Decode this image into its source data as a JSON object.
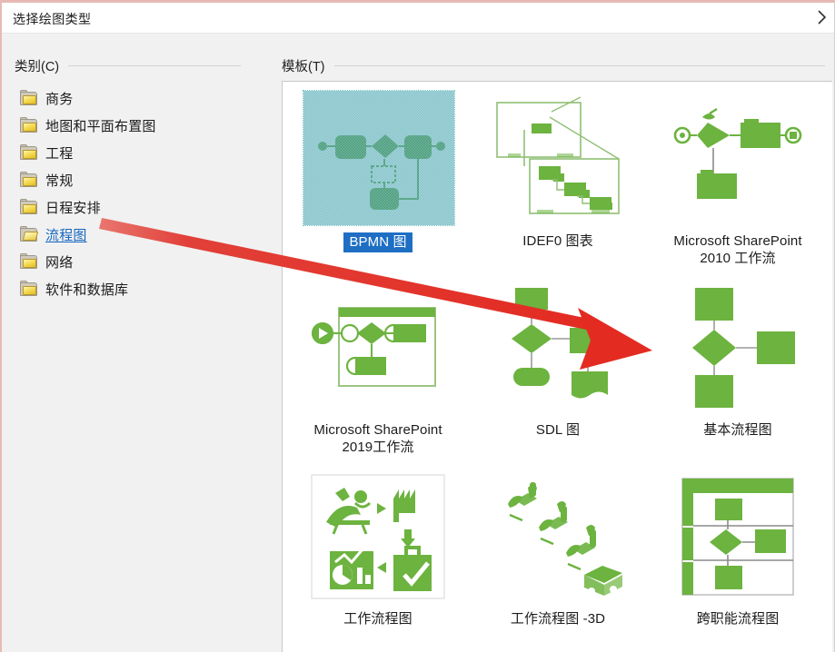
{
  "window": {
    "title": "选择绘图类型",
    "close_glyph": "›"
  },
  "sidebar": {
    "label": "类别(C)",
    "items": [
      {
        "label": "商务",
        "icon": "folder-icon",
        "selected": false
      },
      {
        "label": "地图和平面布置图",
        "icon": "folder-icon",
        "selected": false
      },
      {
        "label": "工程",
        "icon": "folder-icon",
        "selected": false
      },
      {
        "label": "常规",
        "icon": "folder-icon",
        "selected": false
      },
      {
        "label": "日程安排",
        "icon": "folder-icon",
        "selected": false
      },
      {
        "label": "流程图",
        "icon": "folder-open-icon",
        "selected": true
      },
      {
        "label": "网络",
        "icon": "folder-icon",
        "selected": false
      },
      {
        "label": "软件和数据库",
        "icon": "folder-icon",
        "selected": false
      }
    ]
  },
  "templates": {
    "label": "模板(T)",
    "items": [
      {
        "name": "BPMN 图",
        "thumb": "bpmn-thumbnail",
        "selected": true
      },
      {
        "name": "IDEF0 图表",
        "thumb": "idef0-thumbnail",
        "selected": false
      },
      {
        "name": "Microsoft SharePoint\n2010 工作流",
        "thumb": "sharepoint-2010-thumbnail",
        "selected": false
      },
      {
        "name": "Microsoft SharePoint\n2019工作流",
        "thumb": "sharepoint-2019-thumbnail",
        "selected": false
      },
      {
        "name": "SDL 图",
        "thumb": "sdl-thumbnail",
        "selected": false
      },
      {
        "name": "基本流程图",
        "thumb": "basic-flowchart-thumbnail",
        "selected": false
      },
      {
        "name": "工作流程图",
        "thumb": "workflow-thumbnail",
        "selected": false
      },
      {
        "name": "工作流程图 -3D",
        "thumb": "workflow-3d-thumbnail",
        "selected": false
      },
      {
        "name": "跨职能流程图",
        "thumb": "cross-functional-thumbnail",
        "selected": false
      }
    ]
  },
  "annotation": {
    "type": "red-arrow",
    "color": "#e02b23",
    "from_label": "流程图",
    "to_label": "基本流程图"
  },
  "colors": {
    "accent_green": "#6eb councils",
    "green": "#6cb33f",
    "selection_blue": "#1e6fc4",
    "selection_teal": "#40a1ad",
    "link_blue": "#1565c0",
    "arrow_red": "#e02b23",
    "dialog_border": "#e8b9b4"
  }
}
